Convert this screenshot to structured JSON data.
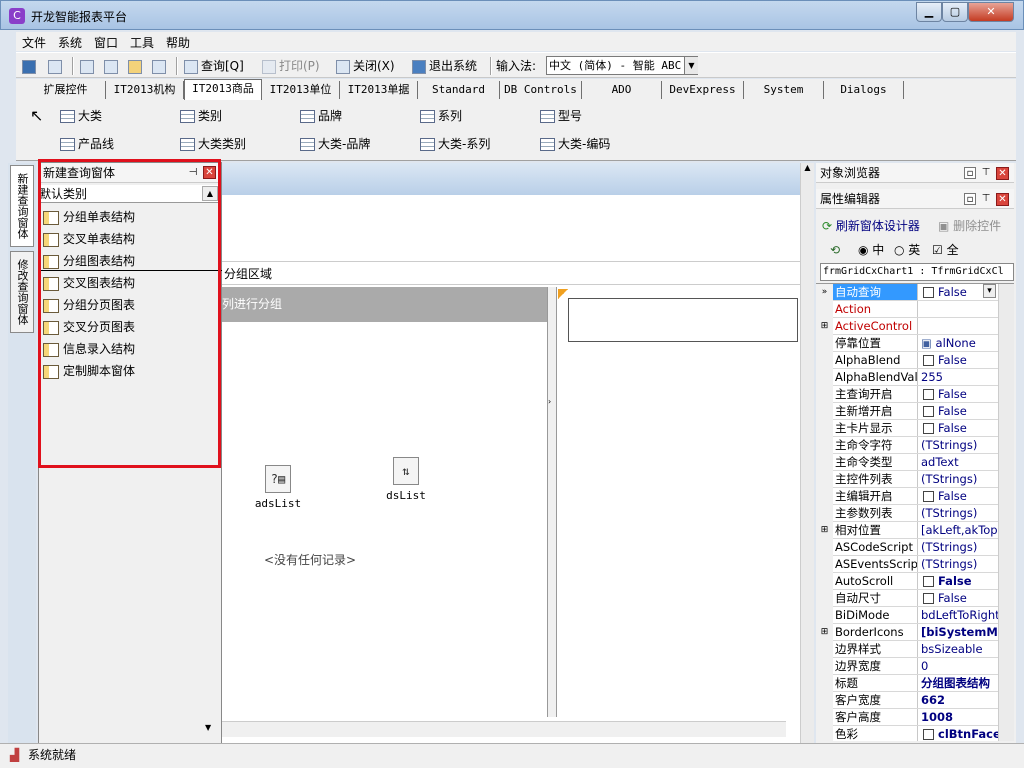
{
  "window": {
    "title": "开龙智能报表平台",
    "min": "▁",
    "max": "▢",
    "close": "✕"
  },
  "menu": [
    "文件",
    "系统",
    "窗口",
    "工具",
    "帮助"
  ],
  "toolbar": {
    "query": "查询[Q]",
    "print": "打印(P)",
    "close": "关闭(X)",
    "exit": "退出系统",
    "ime_label": "输入法:",
    "ime_value": "中文 (简体) - 智能 ABC"
  },
  "palette": {
    "tabs": [
      "扩展控件",
      "IT2013机构",
      "IT2013商品",
      "IT2013单位",
      "IT2013单据",
      "Standard",
      "DB Controls",
      "ADO",
      "DevExpress",
      "System",
      "Dialogs"
    ],
    "row1": [
      "大类",
      "类别",
      "品牌",
      "系列",
      "型号"
    ],
    "row2": [
      "产品线",
      "大类类别",
      "大类-品牌",
      "大类-系列",
      "大类-编码"
    ]
  },
  "left_tabs": [
    "新建查询窗体",
    "修改查询窗体"
  ],
  "query_panel": {
    "title": "新建查询窗体",
    "category": "默认类别",
    "items": [
      "分组单表结构",
      "交叉单表结构",
      "分组图表结构",
      "交叉图表结构",
      "分组分页图表",
      "交叉分页图表",
      "信息录入结构",
      "定制脚本窗体"
    ]
  },
  "designer": {
    "group_area": "分组区域",
    "group_hint": "列进行分组",
    "components": [
      "adsList",
      "dsList"
    ],
    "no_records": "<没有任何记录>"
  },
  "object_browser": {
    "title": "对象浏览器"
  },
  "property_editor": {
    "title": "属性编辑器",
    "refresh": "刷新窗体设计器",
    "delete": "删除控件",
    "radio_cn": "中",
    "radio_en": "英",
    "check_all": "全",
    "object_name": "frmGridCxChart1",
    "object_type": "TfrmGridCxCl",
    "rows": [
      {
        "name": "自动查询",
        "value": "False",
        "check": true,
        "selected": true,
        "dropdown": true
      },
      {
        "name": "Action",
        "value": "",
        "red": true
      },
      {
        "name": "ActiveControl",
        "value": "",
        "red": true,
        "expand": true
      },
      {
        "name": "停靠位置",
        "value": "alNone",
        "enum": true
      },
      {
        "name": "AlphaBlend",
        "value": "False",
        "check": true
      },
      {
        "name": "AlphaBlendValue",
        "value": "255"
      },
      {
        "name": "主查询开启",
        "value": "False",
        "check": true
      },
      {
        "name": "主新增开启",
        "value": "False",
        "check": true
      },
      {
        "name": "主卡片显示",
        "value": "False",
        "check": true
      },
      {
        "name": "主命令字符",
        "value": "(TStrings)"
      },
      {
        "name": "主命令类型",
        "value": "adText"
      },
      {
        "name": "主控件列表",
        "value": "(TStrings)"
      },
      {
        "name": "主编辑开启",
        "value": "False",
        "check": true
      },
      {
        "name": "主参数列表",
        "value": "(TStrings)"
      },
      {
        "name": "相对位置",
        "value": "[akLeft,akTop]",
        "expand": true
      },
      {
        "name": "ASCodeScript",
        "value": "(TStrings)"
      },
      {
        "name": "ASEventsScript",
        "value": "(TStrings)"
      },
      {
        "name": "AutoScroll",
        "value": "False",
        "check": true,
        "bold": true
      },
      {
        "name": "自动尺寸",
        "value": "False",
        "check": true
      },
      {
        "name": "BiDiMode",
        "value": "bdLeftToRight"
      },
      {
        "name": "BorderIcons",
        "value": "[biSystemMer",
        "expand": true,
        "bold": true
      },
      {
        "name": "边界样式",
        "value": "bsSizeable"
      },
      {
        "name": "边界宽度",
        "value": "0"
      },
      {
        "name": "标题",
        "value": "分组图表结构",
        "bold": true
      },
      {
        "name": "客户宽度",
        "value": "662",
        "bold": true
      },
      {
        "name": "客户高度",
        "value": "1008",
        "bold": true
      },
      {
        "name": "色彩",
        "value": "clBtnFace",
        "check": true,
        "bold": true
      }
    ]
  },
  "status": {
    "text": "系统就绪"
  }
}
